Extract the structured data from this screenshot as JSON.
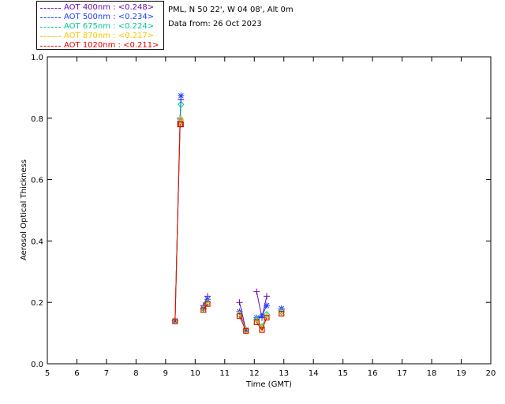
{
  "header": {
    "site": "PML, N 50 22', W 04 08', Alt 0m",
    "date": "Data from: 26 Oct 2023"
  },
  "legend": [
    {
      "label": "AOT  400nm : <0.248>",
      "color": "#6a0dad"
    },
    {
      "label": "AOT  500nm : <0.234>",
      "color": "#1e40ff"
    },
    {
      "label": "AOT  675nm : <0.224>",
      "color": "#00c896"
    },
    {
      "label": "AOT  870nm : <0.217>",
      "color": "#f0c800"
    },
    {
      "label": "AOT 1020nm : <0.211>",
      "color": "#e00000"
    }
  ],
  "chart_data": {
    "type": "line",
    "xlabel": "Time (GMT)",
    "ylabel": "Aerosol Optical Thickness",
    "xlim": [
      5,
      20
    ],
    "ylim": [
      0,
      1
    ],
    "xticks": [
      "5",
      "6",
      "7",
      "8",
      "9",
      "10",
      "11",
      "12",
      "13",
      "14",
      "15",
      "16",
      "17",
      "18",
      "19",
      "20"
    ],
    "yticks": [
      "0.0",
      "0.2",
      "0.4",
      "0.6",
      "0.8",
      "1.0"
    ],
    "grid": false,
    "legend_position": "top-left outside",
    "series": [
      {
        "name": "AOT  400nm : <0.248>",
        "color": "#6a0dad",
        "marker": "plus",
        "x": [
          9.32,
          9.49,
          9.52,
          10.28,
          10.42,
          11.5,
          11.72,
          12.08,
          12.26,
          12.42,
          12.92
        ],
        "y": [
          0.14,
          0.8,
          0.86,
          0.19,
          0.22,
          0.2,
          0.11,
          0.235,
          0.15,
          0.22,
          0.175
        ]
      },
      {
        "name": "AOT  500nm : <0.234>",
        "color": "#1e40ff",
        "marker": "asterisk",
        "x": [
          9.32,
          9.49,
          9.52,
          10.28,
          10.42,
          11.5,
          11.72,
          12.08,
          12.26,
          12.42,
          12.92
        ],
        "y": [
          0.14,
          0.79,
          0.873,
          0.18,
          0.21,
          0.17,
          0.11,
          0.15,
          0.155,
          0.19,
          0.18
        ]
      },
      {
        "name": "AOT  675nm : <0.224>",
        "color": "#00c896",
        "marker": "diamond",
        "x": [
          9.32,
          9.49,
          9.52,
          10.28,
          10.42,
          11.5,
          11.72,
          12.08,
          12.26,
          12.42,
          12.92
        ],
        "y": [
          0.14,
          0.78,
          0.845,
          0.18,
          0.2,
          0.16,
          0.11,
          0.145,
          0.12,
          0.16,
          0.17
        ]
      },
      {
        "name": "AOT  870nm : <0.217>",
        "color": "#f0c800",
        "marker": "triangle",
        "x": [
          9.32,
          9.49,
          9.52,
          10.28,
          10.42,
          11.5,
          11.72,
          12.08,
          12.26,
          12.42,
          12.92
        ],
        "y": [
          0.14,
          0.78,
          0.8,
          0.175,
          0.195,
          0.16,
          0.11,
          0.14,
          0.115,
          0.155,
          0.165
        ]
      },
      {
        "name": "AOT 1020nm : <0.211>",
        "color": "#e00000",
        "marker": "square",
        "x": [
          9.32,
          9.49,
          9.52,
          10.28,
          10.42,
          11.5,
          11.72,
          12.08,
          12.26,
          12.42,
          12.92
        ],
        "y": [
          0.138,
          0.78,
          0.78,
          0.175,
          0.195,
          0.155,
          0.107,
          0.135,
          0.11,
          0.15,
          0.163
        ]
      }
    ]
  }
}
